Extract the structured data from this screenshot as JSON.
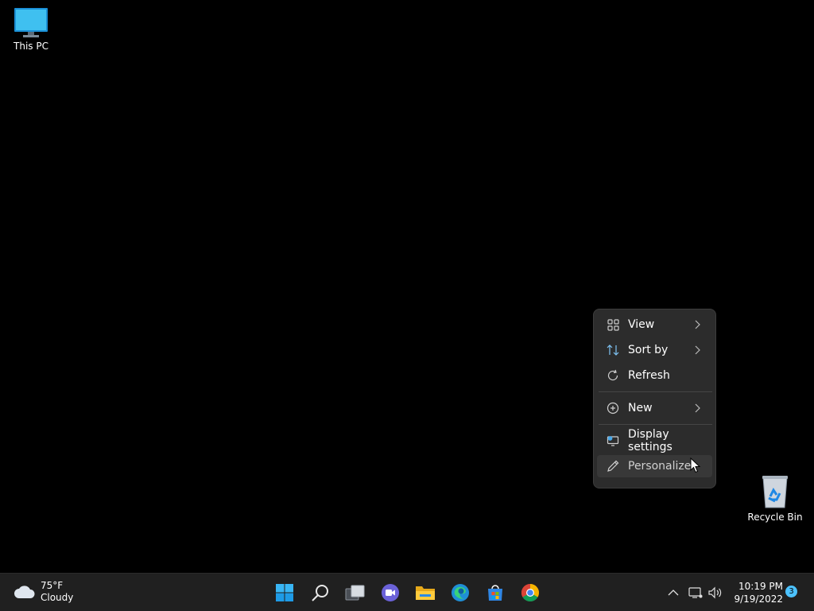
{
  "desktop": {
    "icons": [
      {
        "label": "This PC"
      },
      {
        "label": "Recycle Bin"
      }
    ]
  },
  "context_menu": {
    "items": [
      {
        "label": "View",
        "icon": "view-grid-icon",
        "has_submenu": true
      },
      {
        "label": "Sort by",
        "icon": "sort-icon",
        "has_submenu": true
      },
      {
        "label": "Refresh",
        "icon": "refresh-icon",
        "has_submenu": false
      },
      {
        "label": "New",
        "icon": "new-plus-icon",
        "has_submenu": true
      },
      {
        "label": "Display settings",
        "icon": "display-settings-icon",
        "has_submenu": false
      },
      {
        "label": "Personalize",
        "icon": "personalize-pen-icon",
        "has_submenu": false,
        "hovered": true
      }
    ]
  },
  "taskbar": {
    "weather": {
      "temp": "75°F",
      "condition": "Cloudy",
      "icon": "cloud-icon"
    },
    "pinned": [
      {
        "name": "start-button",
        "icon": "windows-logo-icon"
      },
      {
        "name": "search-button",
        "icon": "search-icon"
      },
      {
        "name": "task-view-button",
        "icon": "task-view-icon"
      },
      {
        "name": "teams-chat-button",
        "icon": "chat-icon"
      },
      {
        "name": "file-explorer-button",
        "icon": "folder-icon"
      },
      {
        "name": "edge-button",
        "icon": "edge-icon"
      },
      {
        "name": "store-button",
        "icon": "store-icon"
      },
      {
        "name": "chrome-button",
        "icon": "chrome-icon"
      }
    ],
    "tray": {
      "time": "10:19 PM",
      "date": "9/19/2022",
      "notification_count": "3"
    }
  },
  "colors": {
    "desktop_bg": "#000000",
    "taskbar_bg": "#202020",
    "menu_bg": "#2c2c2c",
    "accent": "#4cc2ff"
  }
}
